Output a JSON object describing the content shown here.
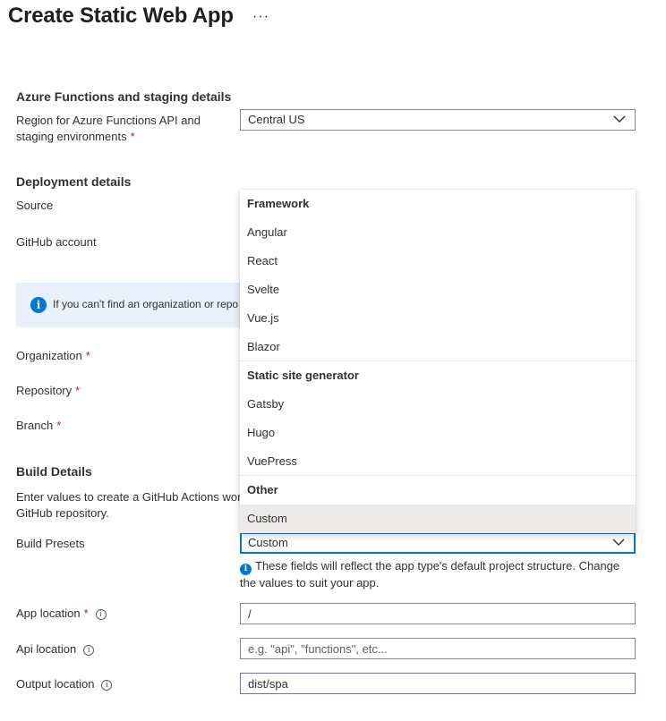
{
  "header": {
    "title": "Create Static Web App",
    "more_label": "···"
  },
  "functions_section": {
    "heading": "Azure Functions and staging details",
    "region_label_line1": "Region for Azure Functions API and",
    "region_label_line2": "staging environments",
    "region_value": "Central US"
  },
  "deployment_section": {
    "heading": "Deployment details",
    "source_label": "Source",
    "github_account_label": "GitHub account",
    "info_text": "If you can't find an organization or repo",
    "organization_label": "Organization",
    "repository_label": "Repository",
    "branch_label": "Branch"
  },
  "required_marker": "*",
  "info_glyph": "i",
  "build_section": {
    "heading": "Build Details",
    "description_line1": "Enter values to create a GitHub Actions wor",
    "description_line2": "GitHub repository.",
    "build_presets_label": "Build Presets",
    "build_presets_value": "Custom",
    "hint_text": "These fields will reflect the app type's default project structure. Change the values to suit your app.",
    "app_location_label": "App location",
    "app_location_value": "/",
    "api_location_label": "Api location",
    "api_location_placeholder": "e.g. \"api\", \"functions\", etc...",
    "output_location_label": "Output location",
    "output_location_value": "dist/spa"
  },
  "dropdown": {
    "groups": [
      {
        "header": "Framework",
        "options": [
          "Angular",
          "React",
          "Svelte",
          "Vue.js",
          "Blazor"
        ]
      },
      {
        "header": "Static site generator",
        "options": [
          "Gatsby",
          "Hugo",
          "VuePress"
        ]
      },
      {
        "header": "Other",
        "options": [
          "Custom"
        ]
      }
    ],
    "selected": "Custom"
  },
  "colors": {
    "accent": "#0078d4",
    "required": "#a4262c",
    "info_bar_bg": "#e7f0fb",
    "selected_option_bg": "#edebe9",
    "output_border": "#8764b8"
  },
  "icons": {
    "more": "more-icon",
    "chevron": "chevron-down-icon",
    "info": "info-icon"
  }
}
